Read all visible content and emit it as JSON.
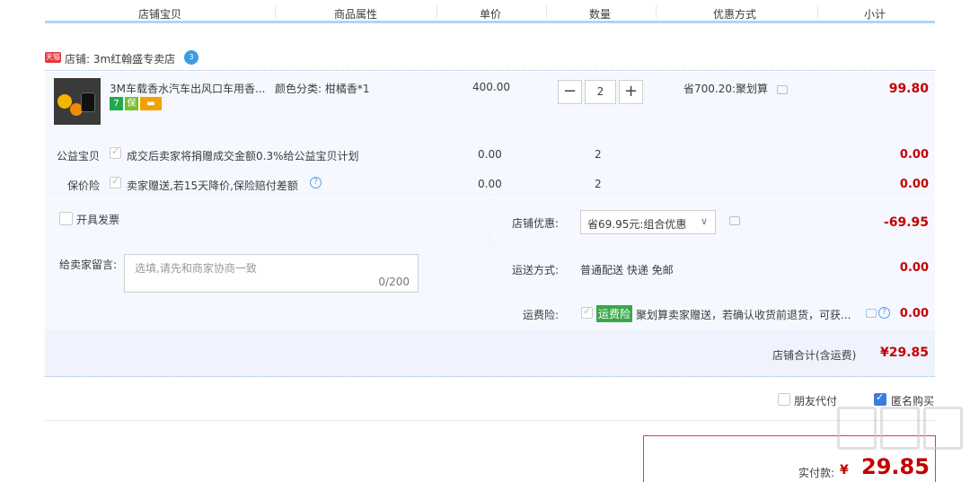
{
  "header": {
    "col_shop_item": "店铺宝贝",
    "col_attrs": "商品属性",
    "col_unit_price": "单价",
    "col_qty": "数量",
    "col_promo": "优惠方式",
    "col_subtotal": "小计"
  },
  "shop": {
    "badge": "天猫",
    "name": "店铺: 3m红翰盛专卖店",
    "wang_icon_text": "3"
  },
  "item": {
    "title": "3M车载香水汽车出风口车用香...",
    "badges": [
      {
        "icon": "seven-day-return-icon",
        "text": "7",
        "color": "#22a94b"
      },
      {
        "icon": "shield-icon",
        "text": "保",
        "color": "#78c02f"
      },
      {
        "icon": "card-icon",
        "text": "▬",
        "color": "#f2a100"
      }
    ],
    "attr": "颜色分类: 柑橘香*1",
    "price": "400.00",
    "qty_minus": "−",
    "qty": "2",
    "qty_plus": "+",
    "promo": "省700.20:聚划算",
    "subtotal": "99.80"
  },
  "charity": {
    "label": "公益宝贝",
    "desc": "成交后卖家将捐赠成交金额0.3%给公益宝贝计划",
    "price": "0.00",
    "qty": "2",
    "subtotal": "0.00"
  },
  "price_protect": {
    "label": "保价险",
    "desc": "卖家赠送,若15天降价,保险赔付差额",
    "price": "0.00",
    "qty": "2",
    "subtotal": "0.00",
    "help": "?"
  },
  "order": {
    "invoice_label": "开具发票",
    "message_label": "给卖家留言:",
    "message_placeholder": "选填,请先和商家协商一致",
    "message_count": "0/200",
    "shop_discount_label": "店铺优惠:",
    "shop_discount_value": "省69.95元:组合优惠",
    "shop_discount_amount": "-69.95",
    "shipping_label": "运送方式:",
    "shipping_value": "普通配送 快递 免邮",
    "shipping_amount": "0.00",
    "freight_ins_label": "运费险:",
    "freight_ins_tag": "运费险",
    "freight_ins_desc": "聚划算卖家赠送，若确认收货前退货，可获...",
    "freight_ins_amount": "0.00",
    "shop_total_label": "店铺合计(含运费)",
    "shop_total_value": "¥29.85"
  },
  "options": {
    "friend_pay": "朋友代付",
    "anonymous": "匿名购买"
  },
  "payment": {
    "label": "实付款:",
    "currency": "¥",
    "amount": "29.85"
  },
  "colors": {
    "accent_red": "#c40000",
    "header_border": "#b2d1ff",
    "item_bg": "#f5f8ff"
  }
}
